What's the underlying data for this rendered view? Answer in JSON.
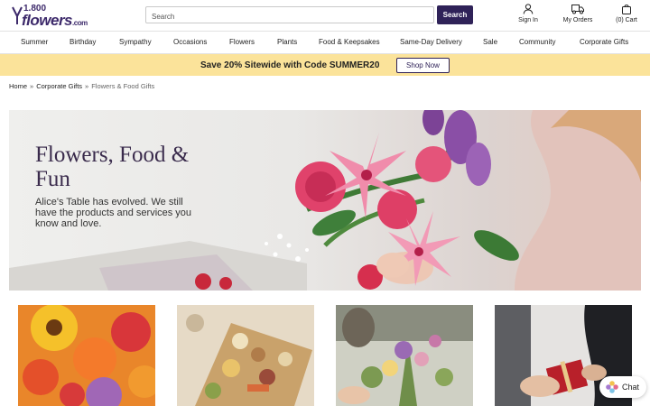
{
  "brand": {
    "logo_number": "1.800",
    "logo_word": "flowers",
    "logo_suffix": ".com"
  },
  "search": {
    "placeholder": "Search",
    "button_label": "Search"
  },
  "header_actions": {
    "sign_in": "Sign In",
    "my_orders": "My Orders",
    "cart": "(0) Cart"
  },
  "nav": {
    "items": [
      "Summer",
      "Birthday",
      "Sympathy",
      "Occasions",
      "Flowers",
      "Plants",
      "Food & Keepsakes",
      "Same-Day Delivery",
      "Sale",
      "Community",
      "Corporate Gifts"
    ]
  },
  "promo": {
    "text": "Save 20% Sitewide with Code SUMMER20",
    "button_label": "Shop Now"
  },
  "breadcrumb": {
    "home": "Home",
    "section": "Corporate Gifts",
    "current": "Flowers & Food Gifts",
    "separator": "»"
  },
  "hero": {
    "title": "Flowers, Food & Fun",
    "subtitle": "Alice's Table has evolved. We still have the products and services you know and love."
  },
  "chat": {
    "label": "Chat"
  },
  "colors": {
    "brand_purple": "#2f2258",
    "promo_yellow": "#fbe39a",
    "hero_title": "#3a2b4c"
  }
}
